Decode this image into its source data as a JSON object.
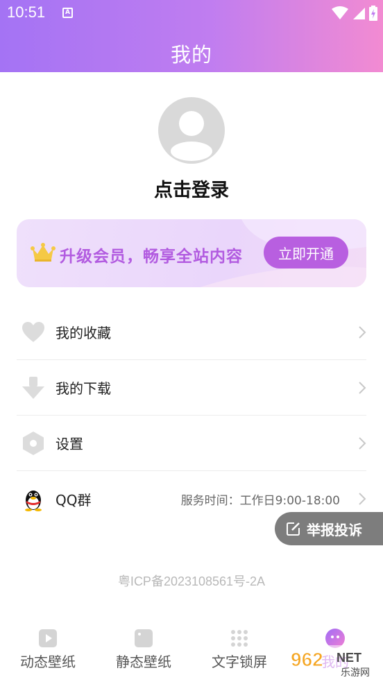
{
  "status_bar": {
    "time": "10:51",
    "badge": "A"
  },
  "header": {
    "title": "我的"
  },
  "profile": {
    "login_text": "点击登录"
  },
  "vip": {
    "text": "升级会员，畅享全站内容",
    "button": "立即开通"
  },
  "menu": {
    "items": [
      {
        "label": "我的收藏",
        "icon": "heart-icon"
      },
      {
        "label": "我的下载",
        "icon": "download-icon"
      },
      {
        "label": "设置",
        "icon": "settings-icon"
      },
      {
        "label": "QQ群",
        "icon": "qq-penguin-icon",
        "extra": "服务时间：工作日9:00-18:00"
      }
    ]
  },
  "report": {
    "label": "举报投诉"
  },
  "footer": {
    "icp": "粤ICP备2023108561号-2A"
  },
  "nav": {
    "items": [
      {
        "label": "动态壁纸",
        "icon": "play-icon"
      },
      {
        "label": "静态壁纸",
        "icon": "image-icon"
      },
      {
        "label": "文字锁屏",
        "icon": "dots-grid-icon"
      },
      {
        "label": "我的",
        "icon": "profile-face-icon",
        "active": true
      }
    ]
  },
  "watermark": {
    "number": "962",
    "suffix": "NET",
    "site": "乐游网"
  },
  "colors": {
    "accent": "#b85fe0",
    "header_start": "#a473f4",
    "header_end": "#f28bd2"
  }
}
